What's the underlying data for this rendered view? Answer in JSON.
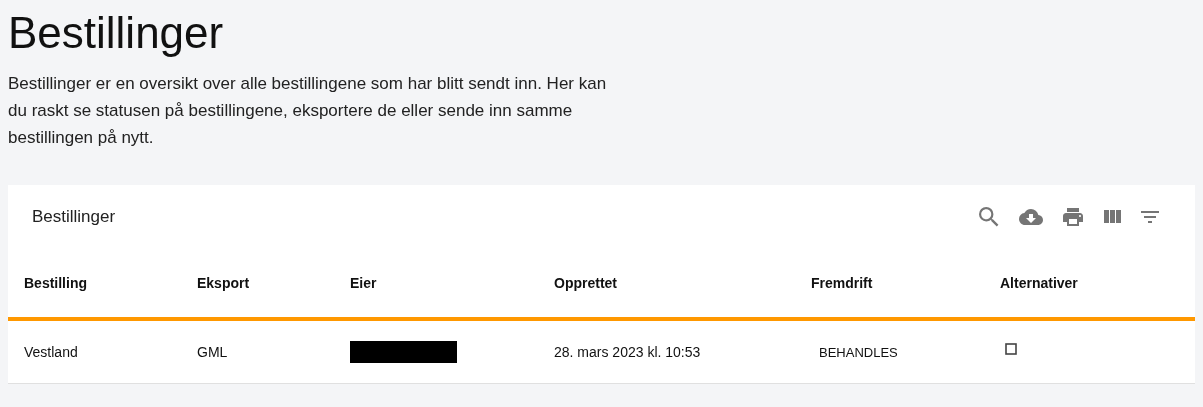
{
  "page": {
    "title": "Bestillinger",
    "description": "Bestillinger er en oversikt over alle bestillingene som har blitt sendt inn. Her kan du raskt se statusen på bestillingene, eksportere de eller sende inn samme bestillingen på nytt."
  },
  "table": {
    "title": "Bestillinger",
    "columns": [
      "Bestilling",
      "Eksport",
      "Eier",
      "Opprettet",
      "Fremdrift",
      "Alternativer"
    ],
    "rows": [
      {
        "bestilling": "Vestland",
        "eksport": "GML",
        "eier_redacted": true,
        "opprettet": "28. mars 2023 kl. 10:53",
        "fremdrift": "BEHANDLES"
      }
    ]
  }
}
